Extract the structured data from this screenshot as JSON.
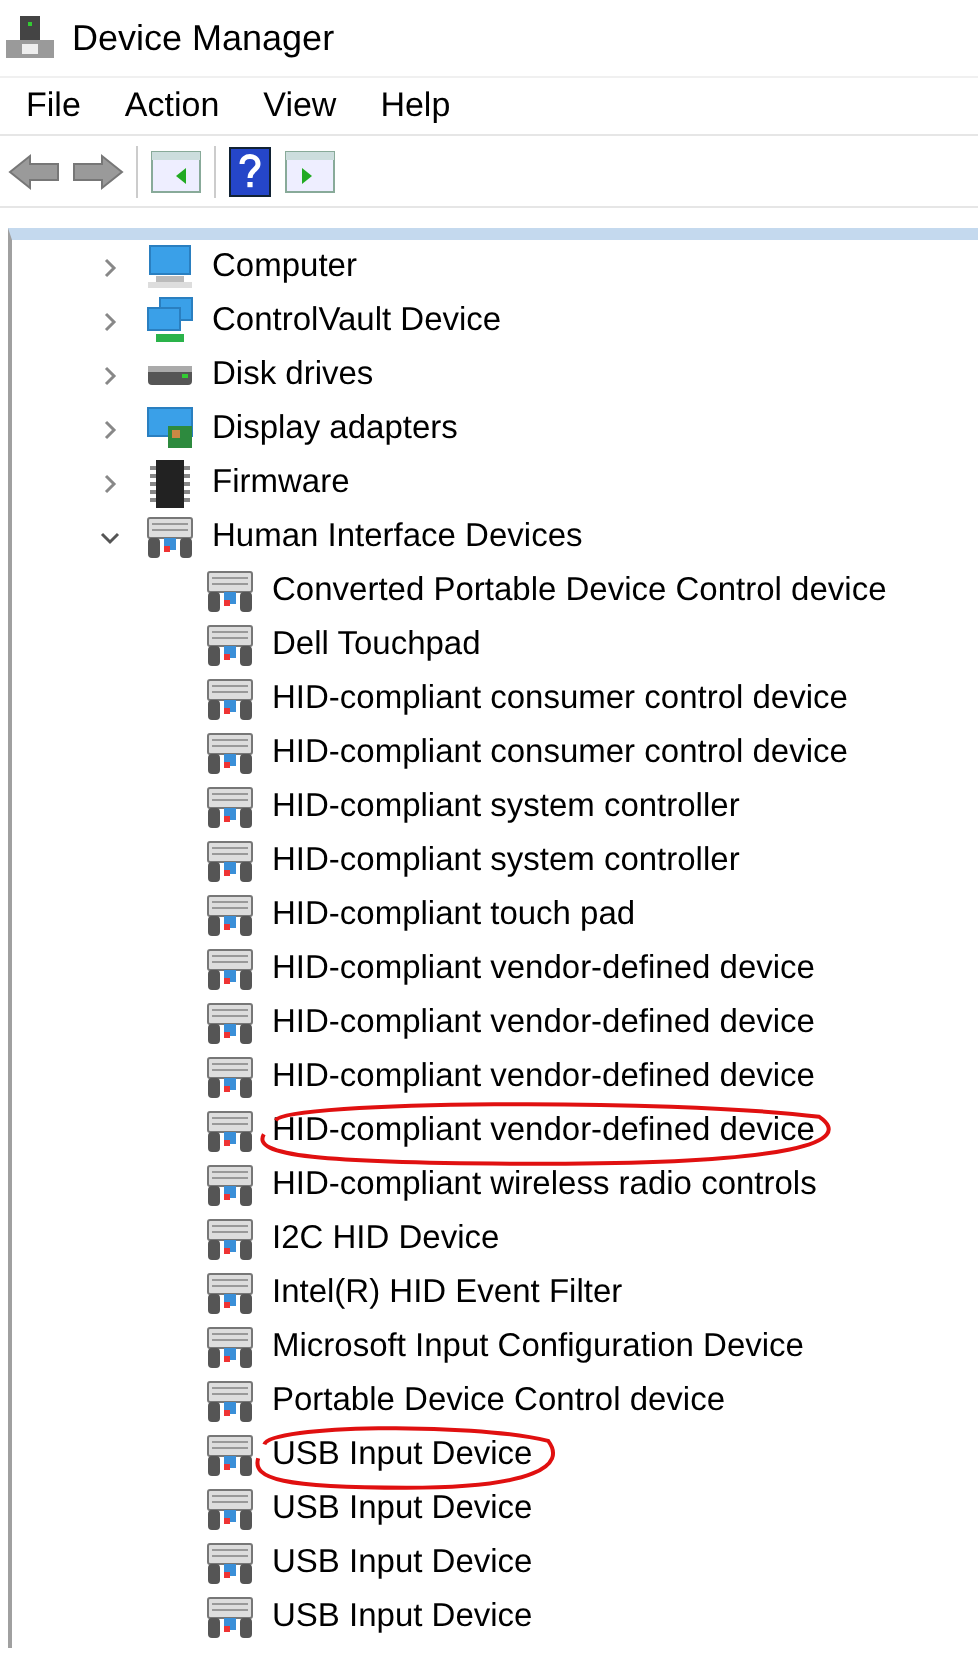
{
  "window": {
    "title": "Device Manager"
  },
  "menu": [
    "File",
    "Action",
    "View",
    "Help"
  ],
  "tree": [
    {
      "label": "Computer",
      "kind": "computer",
      "expanded": false
    },
    {
      "label": "ControlVault Device",
      "kind": "network",
      "expanded": false
    },
    {
      "label": "Disk drives",
      "kind": "disk",
      "expanded": false
    },
    {
      "label": "Display adapters",
      "kind": "display",
      "expanded": false
    },
    {
      "label": "Firmware",
      "kind": "firmware",
      "expanded": false
    },
    {
      "label": "Human Interface Devices",
      "kind": "hid",
      "expanded": true,
      "children": [
        {
          "label": "Converted Portable Device Control device",
          "kind": "hid",
          "circled": false
        },
        {
          "label": "Dell Touchpad",
          "kind": "hid",
          "circled": false
        },
        {
          "label": "HID-compliant consumer control device",
          "kind": "hid",
          "circled": false
        },
        {
          "label": "HID-compliant consumer control device",
          "kind": "hid",
          "circled": false
        },
        {
          "label": "HID-compliant system controller",
          "kind": "hid",
          "circled": false
        },
        {
          "label": "HID-compliant system controller",
          "kind": "hid",
          "circled": false
        },
        {
          "label": "HID-compliant touch pad",
          "kind": "hid",
          "circled": false
        },
        {
          "label": "HID-compliant vendor-defined device",
          "kind": "hid",
          "circled": false
        },
        {
          "label": "HID-compliant vendor-defined device",
          "kind": "hid",
          "circled": false
        },
        {
          "label": "HID-compliant vendor-defined device",
          "kind": "hid",
          "circled": false
        },
        {
          "label": "HID-compliant vendor-defined device",
          "kind": "hid",
          "circled": true
        },
        {
          "label": "HID-compliant wireless radio controls",
          "kind": "hid",
          "circled": false
        },
        {
          "label": "I2C HID Device",
          "kind": "hid",
          "circled": false
        },
        {
          "label": "Intel(R) HID Event Filter",
          "kind": "hid",
          "circled": false
        },
        {
          "label": "Microsoft Input Configuration Device",
          "kind": "hid",
          "circled": false
        },
        {
          "label": "Portable Device Control device",
          "kind": "hid",
          "circled": false
        },
        {
          "label": "USB Input Device",
          "kind": "hid",
          "circled": true
        },
        {
          "label": "USB Input Device",
          "kind": "hid",
          "circled": false
        },
        {
          "label": "USB Input Device",
          "kind": "hid",
          "circled": false
        },
        {
          "label": "USB Input Device",
          "kind": "hid",
          "circled": false
        }
      ]
    }
  ]
}
